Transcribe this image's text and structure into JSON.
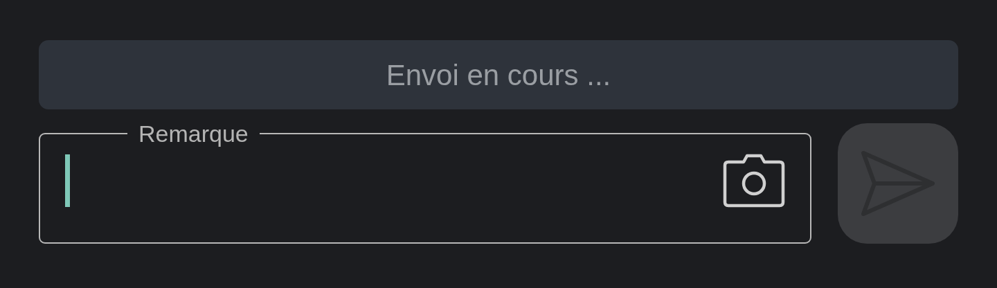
{
  "status_banner": {
    "text": "Envoi en cours ..."
  },
  "remark_field": {
    "label": "Remarque",
    "focused": true
  },
  "send_button": {
    "disabled": true
  }
}
